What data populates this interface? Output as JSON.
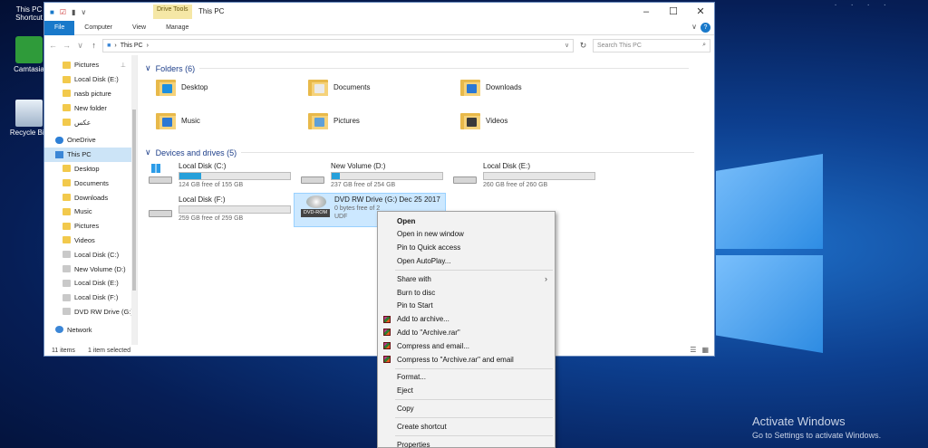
{
  "desktop": {
    "icons": [
      {
        "label": "This PC Shortcut"
      },
      {
        "label": "Camtasia"
      },
      {
        "label": "Recycle Bin"
      }
    ],
    "watermark": {
      "line1": "Activate Windows",
      "line2": "Go to Settings to activate Windows."
    }
  },
  "window": {
    "title": "This PC",
    "contextual_tab": "Drive Tools",
    "ribbon_tabs": [
      "File",
      "Computer",
      "View",
      "Manage"
    ],
    "address": "This PC",
    "search_placeholder": "Search This PC"
  },
  "nav_pane": [
    {
      "label": "Pictures",
      "icon": "folder-icon",
      "pinned": true
    },
    {
      "label": "Local Disk (E:)",
      "icon": "folder-icon"
    },
    {
      "label": "nasb picture",
      "icon": "folder-icon"
    },
    {
      "label": "New folder",
      "icon": "folder-icon"
    },
    {
      "label": "عكس",
      "icon": "folder-icon"
    },
    {
      "label": "OneDrive",
      "icon": "onedrive-icon"
    },
    {
      "label": "This PC",
      "icon": "this-pc-icon",
      "selected": true
    },
    {
      "label": "Desktop",
      "icon": "folder-icon"
    },
    {
      "label": "Documents",
      "icon": "folder-icon"
    },
    {
      "label": "Downloads",
      "icon": "folder-icon"
    },
    {
      "label": "Music",
      "icon": "folder-icon"
    },
    {
      "label": "Pictures",
      "icon": "folder-icon"
    },
    {
      "label": "Videos",
      "icon": "folder-icon"
    },
    {
      "label": "Local Disk (C:)",
      "icon": "drive-icon"
    },
    {
      "label": "New Volume (D:)",
      "icon": "drive-icon"
    },
    {
      "label": "Local Disk (E:)",
      "icon": "drive-icon"
    },
    {
      "label": "Local Disk (F:)",
      "icon": "drive-icon"
    },
    {
      "label": "DVD RW Drive (G:)",
      "icon": "dvd-icon"
    },
    {
      "label": "Network",
      "icon": "network-icon"
    }
  ],
  "folders": {
    "header": "Folders (6)",
    "items": [
      "Desktop",
      "Documents",
      "Downloads",
      "Music",
      "Pictures",
      "Videos"
    ]
  },
  "drives": {
    "header": "Devices and drives (5)",
    "items": [
      {
        "name": "Local Disk (C:)",
        "free": "124 GB free of 155 GB",
        "used_fraction": 0.2
      },
      {
        "name": "New Volume (D:)",
        "free": "237 GB free of 254 GB",
        "used_fraction": 0.07
      },
      {
        "name": "Local Disk (E:)",
        "free": "260 GB free of 260 GB",
        "used_fraction": 0.0
      },
      {
        "name": "Local Disk (F:)",
        "free": "259 GB free of 259 GB",
        "used_fraction": 0.0
      },
      {
        "name": "DVD RW Drive (G:) Dec 25 2017",
        "free": "0 bytes free of 2",
        "fs": "UDF",
        "tag": "DVD-ROM"
      }
    ]
  },
  "status": {
    "count": "11 items",
    "selection": "1 item selected"
  },
  "context_menu": [
    {
      "label": "Open",
      "bold": true
    },
    {
      "label": "Open in new window"
    },
    {
      "label": "Pin to Quick access"
    },
    {
      "label": "Open AutoPlay..."
    },
    {
      "sep": true
    },
    {
      "label": "Share with",
      "submenu": true
    },
    {
      "label": "Burn to disc"
    },
    {
      "label": "Pin to Start"
    },
    {
      "label": "Add to archive...",
      "rar": true
    },
    {
      "label": "Add to \"Archive.rar\"",
      "rar": true
    },
    {
      "label": "Compress and email...",
      "rar": true
    },
    {
      "label": "Compress to \"Archive.rar\" and email",
      "rar": true
    },
    {
      "sep": true
    },
    {
      "label": "Format..."
    },
    {
      "label": "Eject"
    },
    {
      "sep": true
    },
    {
      "label": "Copy"
    },
    {
      "sep": true
    },
    {
      "label": "Create shortcut"
    },
    {
      "sep": true
    },
    {
      "label": "Properties"
    }
  ]
}
